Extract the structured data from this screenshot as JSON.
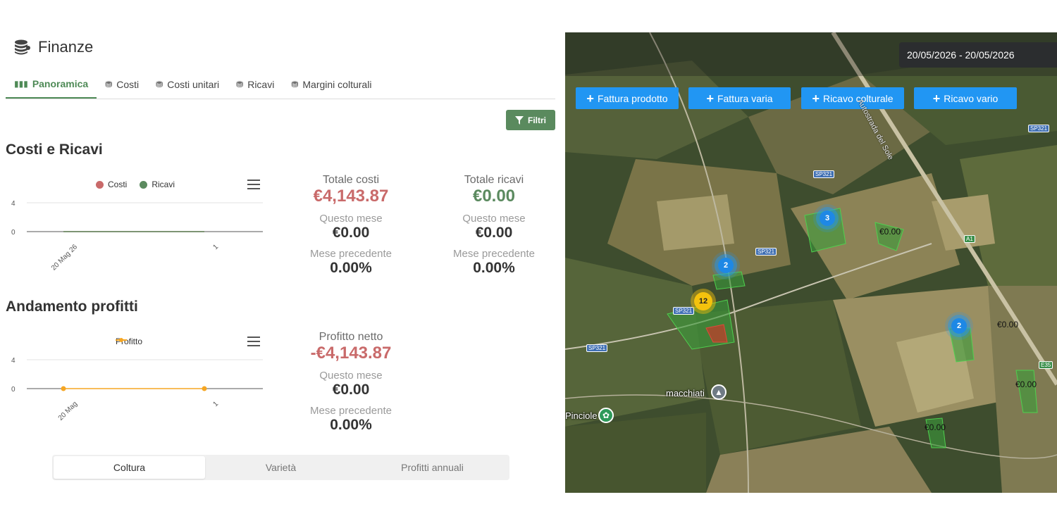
{
  "page": {
    "title": "Finanze"
  },
  "tabs": [
    {
      "label": "Panoramica",
      "active": true
    },
    {
      "label": "Costi"
    },
    {
      "label": "Costi unitari"
    },
    {
      "label": "Ricavi"
    },
    {
      "label": "Margini colturali"
    }
  ],
  "filter_button": "Filtri",
  "costs_revenue": {
    "title": "Costi e Ricavi",
    "legend": [
      "Costi",
      "Ricavi"
    ],
    "totale_costi_label": "Totale costi",
    "totale_costi": "€4,143.87",
    "totale_ricavi_label": "Totale ricavi",
    "totale_ricavi": "€0.00",
    "questo_mese_label": "Questo mese",
    "costi_questo_mese": "€0.00",
    "ricavi_questo_mese": "€0.00",
    "mese_precedente_label": "Mese precedente",
    "costi_mese_precedente": "0.00%",
    "ricavi_mese_precedente": "0.00%"
  },
  "profit": {
    "title": "Andamento profitti",
    "legend": [
      "Profitto"
    ],
    "profitto_netto_label": "Profitto netto",
    "profitto_netto": "-€4,143.87",
    "questo_mese_label": "Questo mese",
    "questo_mese": "€0.00",
    "mese_precedente_label": "Mese precedente",
    "mese_precedente": "0.00%"
  },
  "segments": [
    {
      "label": "Coltura",
      "active": true
    },
    {
      "label": "Varietà"
    },
    {
      "label": "Profitti annuali"
    }
  ],
  "colors": {
    "costi": "#c96a6a",
    "ricavi": "#5b8a5f",
    "profitto": "#f5a623",
    "accent": "#4e8a56",
    "map_button": "#2196f3"
  },
  "chart_data": [
    {
      "type": "line",
      "title": "",
      "categories": [
        "20 Mag 26",
        "1"
      ],
      "series": [
        {
          "name": "Costi",
          "values": [
            0,
            0
          ]
        },
        {
          "name": "Ricavi",
          "values": [
            0,
            0
          ]
        }
      ],
      "yticks": [
        "4",
        "0"
      ],
      "ylim": [
        0,
        4
      ],
      "legend": "top",
      "grid": true
    },
    {
      "type": "line",
      "title": "",
      "categories": [
        "20 Mag",
        "1"
      ],
      "series": [
        {
          "name": "Profitto",
          "values": [
            0,
            0
          ]
        }
      ],
      "yticks": [
        "4",
        "0"
      ],
      "ylim": [
        0,
        4
      ],
      "legend": "top",
      "grid": true
    }
  ],
  "map": {
    "date_range": "20/05/2026 - 20/05/2026",
    "buttons": [
      "Fattura prodotto",
      "Fattura varia",
      "Ricavo colturale",
      "Ricavo vario"
    ],
    "clusters": [
      "3",
      "2",
      "12",
      "2"
    ],
    "field_labels": [
      "€0.00",
      "€0.00",
      "€0.00",
      "€0.00"
    ],
    "road_tags": [
      "SP321",
      "SP321",
      "SP321",
      "SP321",
      "SP321",
      "A1",
      "E35"
    ],
    "places": [
      "macchiati",
      "Pinciole"
    ],
    "street": "Autostrada del Sole"
  }
}
